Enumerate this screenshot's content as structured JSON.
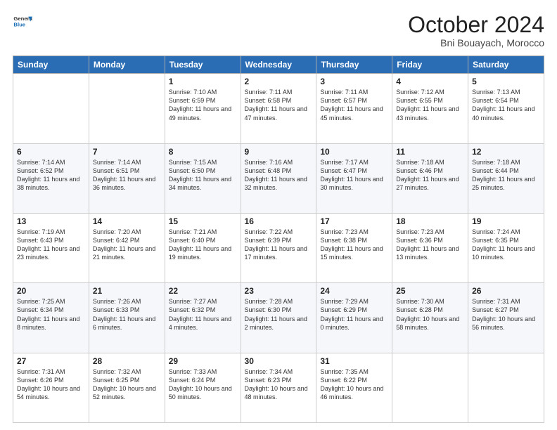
{
  "logo": {
    "line1": "General",
    "line2": "Blue"
  },
  "header": {
    "title": "October 2024",
    "subtitle": "Bni Bouayach, Morocco"
  },
  "columns": [
    "Sunday",
    "Monday",
    "Tuesday",
    "Wednesday",
    "Thursday",
    "Friday",
    "Saturday"
  ],
  "weeks": [
    [
      {
        "date": "",
        "sunrise": "",
        "sunset": "",
        "daylight": ""
      },
      {
        "date": "",
        "sunrise": "",
        "sunset": "",
        "daylight": ""
      },
      {
        "date": "1",
        "sunrise": "Sunrise: 7:10 AM",
        "sunset": "Sunset: 6:59 PM",
        "daylight": "Daylight: 11 hours and 49 minutes."
      },
      {
        "date": "2",
        "sunrise": "Sunrise: 7:11 AM",
        "sunset": "Sunset: 6:58 PM",
        "daylight": "Daylight: 11 hours and 47 minutes."
      },
      {
        "date": "3",
        "sunrise": "Sunrise: 7:11 AM",
        "sunset": "Sunset: 6:57 PM",
        "daylight": "Daylight: 11 hours and 45 minutes."
      },
      {
        "date": "4",
        "sunrise": "Sunrise: 7:12 AM",
        "sunset": "Sunset: 6:55 PM",
        "daylight": "Daylight: 11 hours and 43 minutes."
      },
      {
        "date": "5",
        "sunrise": "Sunrise: 7:13 AM",
        "sunset": "Sunset: 6:54 PM",
        "daylight": "Daylight: 11 hours and 40 minutes."
      }
    ],
    [
      {
        "date": "6",
        "sunrise": "Sunrise: 7:14 AM",
        "sunset": "Sunset: 6:52 PM",
        "daylight": "Daylight: 11 hours and 38 minutes."
      },
      {
        "date": "7",
        "sunrise": "Sunrise: 7:14 AM",
        "sunset": "Sunset: 6:51 PM",
        "daylight": "Daylight: 11 hours and 36 minutes."
      },
      {
        "date": "8",
        "sunrise": "Sunrise: 7:15 AM",
        "sunset": "Sunset: 6:50 PM",
        "daylight": "Daylight: 11 hours and 34 minutes."
      },
      {
        "date": "9",
        "sunrise": "Sunrise: 7:16 AM",
        "sunset": "Sunset: 6:48 PM",
        "daylight": "Daylight: 11 hours and 32 minutes."
      },
      {
        "date": "10",
        "sunrise": "Sunrise: 7:17 AM",
        "sunset": "Sunset: 6:47 PM",
        "daylight": "Daylight: 11 hours and 30 minutes."
      },
      {
        "date": "11",
        "sunrise": "Sunrise: 7:18 AM",
        "sunset": "Sunset: 6:46 PM",
        "daylight": "Daylight: 11 hours and 27 minutes."
      },
      {
        "date": "12",
        "sunrise": "Sunrise: 7:18 AM",
        "sunset": "Sunset: 6:44 PM",
        "daylight": "Daylight: 11 hours and 25 minutes."
      }
    ],
    [
      {
        "date": "13",
        "sunrise": "Sunrise: 7:19 AM",
        "sunset": "Sunset: 6:43 PM",
        "daylight": "Daylight: 11 hours and 23 minutes."
      },
      {
        "date": "14",
        "sunrise": "Sunrise: 7:20 AM",
        "sunset": "Sunset: 6:42 PM",
        "daylight": "Daylight: 11 hours and 21 minutes."
      },
      {
        "date": "15",
        "sunrise": "Sunrise: 7:21 AM",
        "sunset": "Sunset: 6:40 PM",
        "daylight": "Daylight: 11 hours and 19 minutes."
      },
      {
        "date": "16",
        "sunrise": "Sunrise: 7:22 AM",
        "sunset": "Sunset: 6:39 PM",
        "daylight": "Daylight: 11 hours and 17 minutes."
      },
      {
        "date": "17",
        "sunrise": "Sunrise: 7:23 AM",
        "sunset": "Sunset: 6:38 PM",
        "daylight": "Daylight: 11 hours and 15 minutes."
      },
      {
        "date": "18",
        "sunrise": "Sunrise: 7:23 AM",
        "sunset": "Sunset: 6:36 PM",
        "daylight": "Daylight: 11 hours and 13 minutes."
      },
      {
        "date": "19",
        "sunrise": "Sunrise: 7:24 AM",
        "sunset": "Sunset: 6:35 PM",
        "daylight": "Daylight: 11 hours and 10 minutes."
      }
    ],
    [
      {
        "date": "20",
        "sunrise": "Sunrise: 7:25 AM",
        "sunset": "Sunset: 6:34 PM",
        "daylight": "Daylight: 11 hours and 8 minutes."
      },
      {
        "date": "21",
        "sunrise": "Sunrise: 7:26 AM",
        "sunset": "Sunset: 6:33 PM",
        "daylight": "Daylight: 11 hours and 6 minutes."
      },
      {
        "date": "22",
        "sunrise": "Sunrise: 7:27 AM",
        "sunset": "Sunset: 6:32 PM",
        "daylight": "Daylight: 11 hours and 4 minutes."
      },
      {
        "date": "23",
        "sunrise": "Sunrise: 7:28 AM",
        "sunset": "Sunset: 6:30 PM",
        "daylight": "Daylight: 11 hours and 2 minutes."
      },
      {
        "date": "24",
        "sunrise": "Sunrise: 7:29 AM",
        "sunset": "Sunset: 6:29 PM",
        "daylight": "Daylight: 11 hours and 0 minutes."
      },
      {
        "date": "25",
        "sunrise": "Sunrise: 7:30 AM",
        "sunset": "Sunset: 6:28 PM",
        "daylight": "Daylight: 10 hours and 58 minutes."
      },
      {
        "date": "26",
        "sunrise": "Sunrise: 7:31 AM",
        "sunset": "Sunset: 6:27 PM",
        "daylight": "Daylight: 10 hours and 56 minutes."
      }
    ],
    [
      {
        "date": "27",
        "sunrise": "Sunrise: 7:31 AM",
        "sunset": "Sunset: 6:26 PM",
        "daylight": "Daylight: 10 hours and 54 minutes."
      },
      {
        "date": "28",
        "sunrise": "Sunrise: 7:32 AM",
        "sunset": "Sunset: 6:25 PM",
        "daylight": "Daylight: 10 hours and 52 minutes."
      },
      {
        "date": "29",
        "sunrise": "Sunrise: 7:33 AM",
        "sunset": "Sunset: 6:24 PM",
        "daylight": "Daylight: 10 hours and 50 minutes."
      },
      {
        "date": "30",
        "sunrise": "Sunrise: 7:34 AM",
        "sunset": "Sunset: 6:23 PM",
        "daylight": "Daylight: 10 hours and 48 minutes."
      },
      {
        "date": "31",
        "sunrise": "Sunrise: 7:35 AM",
        "sunset": "Sunset: 6:22 PM",
        "daylight": "Daylight: 10 hours and 46 minutes."
      },
      {
        "date": "",
        "sunrise": "",
        "sunset": "",
        "daylight": ""
      },
      {
        "date": "",
        "sunrise": "",
        "sunset": "",
        "daylight": ""
      }
    ]
  ]
}
